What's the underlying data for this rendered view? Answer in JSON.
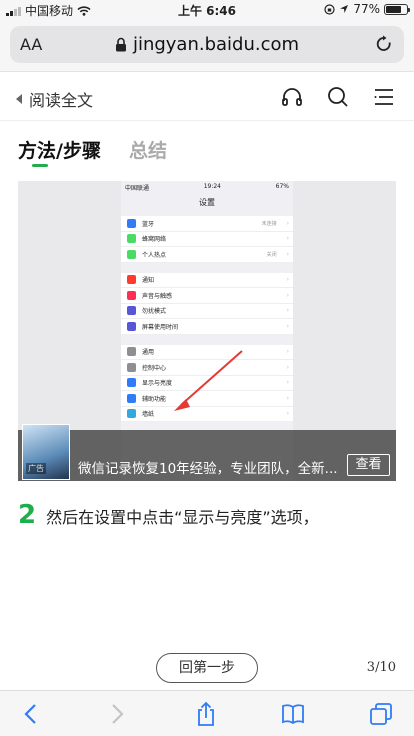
{
  "status_bar": {
    "carrier": "中国移动",
    "time": "上午 6:46",
    "battery": "77%",
    "battery_level": 0.77
  },
  "browser": {
    "text_size_label": "AA",
    "url": "jingyan.baidu.com"
  },
  "page_nav": {
    "back_label": "阅读全文"
  },
  "tabs": [
    {
      "label": "方法/步骤",
      "active": true
    },
    {
      "label": "总结",
      "active": false
    }
  ],
  "screenshot": {
    "status_left": "中国联通",
    "time": "19:24",
    "battery": "67%",
    "title": "设置",
    "groups": [
      [
        {
          "label": "蓝牙",
          "value": "未连接",
          "color": "#2f7cf6"
        },
        {
          "label": "蜂窝网络",
          "value": "",
          "color": "#4cd964"
        },
        {
          "label": "个人热点",
          "value": "关闭",
          "color": "#4cd964"
        }
      ],
      [
        {
          "label": "通知",
          "value": "",
          "color": "#ff3b30"
        },
        {
          "label": "声音与触感",
          "value": "",
          "color": "#ff2d55"
        },
        {
          "label": "勿扰模式",
          "value": "",
          "color": "#5856d6"
        },
        {
          "label": "屏幕使用时间",
          "value": "",
          "color": "#5856d6"
        }
      ],
      [
        {
          "label": "通用",
          "value": "",
          "color": "#8e8e93"
        },
        {
          "label": "控制中心",
          "value": "",
          "color": "#8e8e93"
        },
        {
          "label": "显示与亮度",
          "value": "",
          "color": "#2f7cf6"
        },
        {
          "label": "辅助功能",
          "value": "",
          "color": "#2f7cf6"
        },
        {
          "label": "墙纸",
          "value": "",
          "color": "#34aadc"
        }
      ]
    ]
  },
  "ad": {
    "text": "微信记录恢复10年经验，专业团队，全新...",
    "button_label": "查看",
    "badge": "广告"
  },
  "step": {
    "number": "2",
    "text": "然后在设置中点击“显示与亮度”选项，"
  },
  "pagination": {
    "prev_label": "回第一步",
    "page": "3/10"
  },
  "colors": {
    "accent": "#1fae4e"
  }
}
